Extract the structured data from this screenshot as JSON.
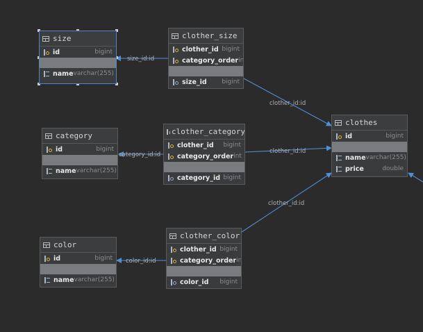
{
  "tables": {
    "size": {
      "name": "size",
      "columns": [
        {
          "name": "id",
          "type": "bigint",
          "key": "pk"
        },
        {
          "name": "name",
          "type": "varchar(255)",
          "key": "none"
        }
      ]
    },
    "clother_size": {
      "name": "clother_size",
      "columns": [
        {
          "name": "clother_id",
          "type": "bigint",
          "key": "pk-fk"
        },
        {
          "name": "category_order",
          "type": "int",
          "key": "pk-fk"
        },
        {
          "name": "size_id",
          "type": "bigint",
          "key": "fk"
        }
      ]
    },
    "category": {
      "name": "category",
      "columns": [
        {
          "name": "id",
          "type": "bigint",
          "key": "pk"
        },
        {
          "name": "name",
          "type": "varchar(255)",
          "key": "none"
        }
      ]
    },
    "clother_category": {
      "name": "clother_category",
      "columns": [
        {
          "name": "clother_id",
          "type": "bigint",
          "key": "pk-fk"
        },
        {
          "name": "category_order",
          "type": "int",
          "key": "pk-fk"
        },
        {
          "name": "category_id",
          "type": "bigint",
          "key": "fk"
        }
      ]
    },
    "clothes": {
      "name": "clothes",
      "columns": [
        {
          "name": "id",
          "type": "bigint",
          "key": "pk"
        },
        {
          "name": "name",
          "type": "varchar(255)",
          "key": "none"
        },
        {
          "name": "price",
          "type": "double",
          "key": "none"
        }
      ]
    },
    "color": {
      "name": "color",
      "columns": [
        {
          "name": "id",
          "type": "bigint",
          "key": "pk"
        },
        {
          "name": "name",
          "type": "varchar(255)",
          "key": "none"
        }
      ]
    },
    "clother_color": {
      "name": "clother_color",
      "columns": [
        {
          "name": "clother_id",
          "type": "bigint",
          "key": "pk-fk"
        },
        {
          "name": "category_order",
          "type": "int",
          "key": "pk-fk"
        },
        {
          "name": "color_id",
          "type": "bigint",
          "key": "fk"
        }
      ]
    }
  },
  "relations": [
    {
      "from": "clother_size",
      "to": "size",
      "label": "size_id:id"
    },
    {
      "from": "clother_size",
      "to": "clothes",
      "label": "clother_id:id"
    },
    {
      "from": "clother_category",
      "to": "category",
      "label": "category_id:id"
    },
    {
      "from": "clother_category",
      "to": "clothes",
      "label": "clother_id:id"
    },
    {
      "from": "clother_color",
      "to": "clothes",
      "label": "clother_id:id"
    },
    {
      "from": "clother_color",
      "to": "color",
      "label": "color_id:id"
    }
  ],
  "colors": {
    "edge": "#4f8fd6",
    "background": "#2b2b2c",
    "selection": "#4e86c8"
  }
}
